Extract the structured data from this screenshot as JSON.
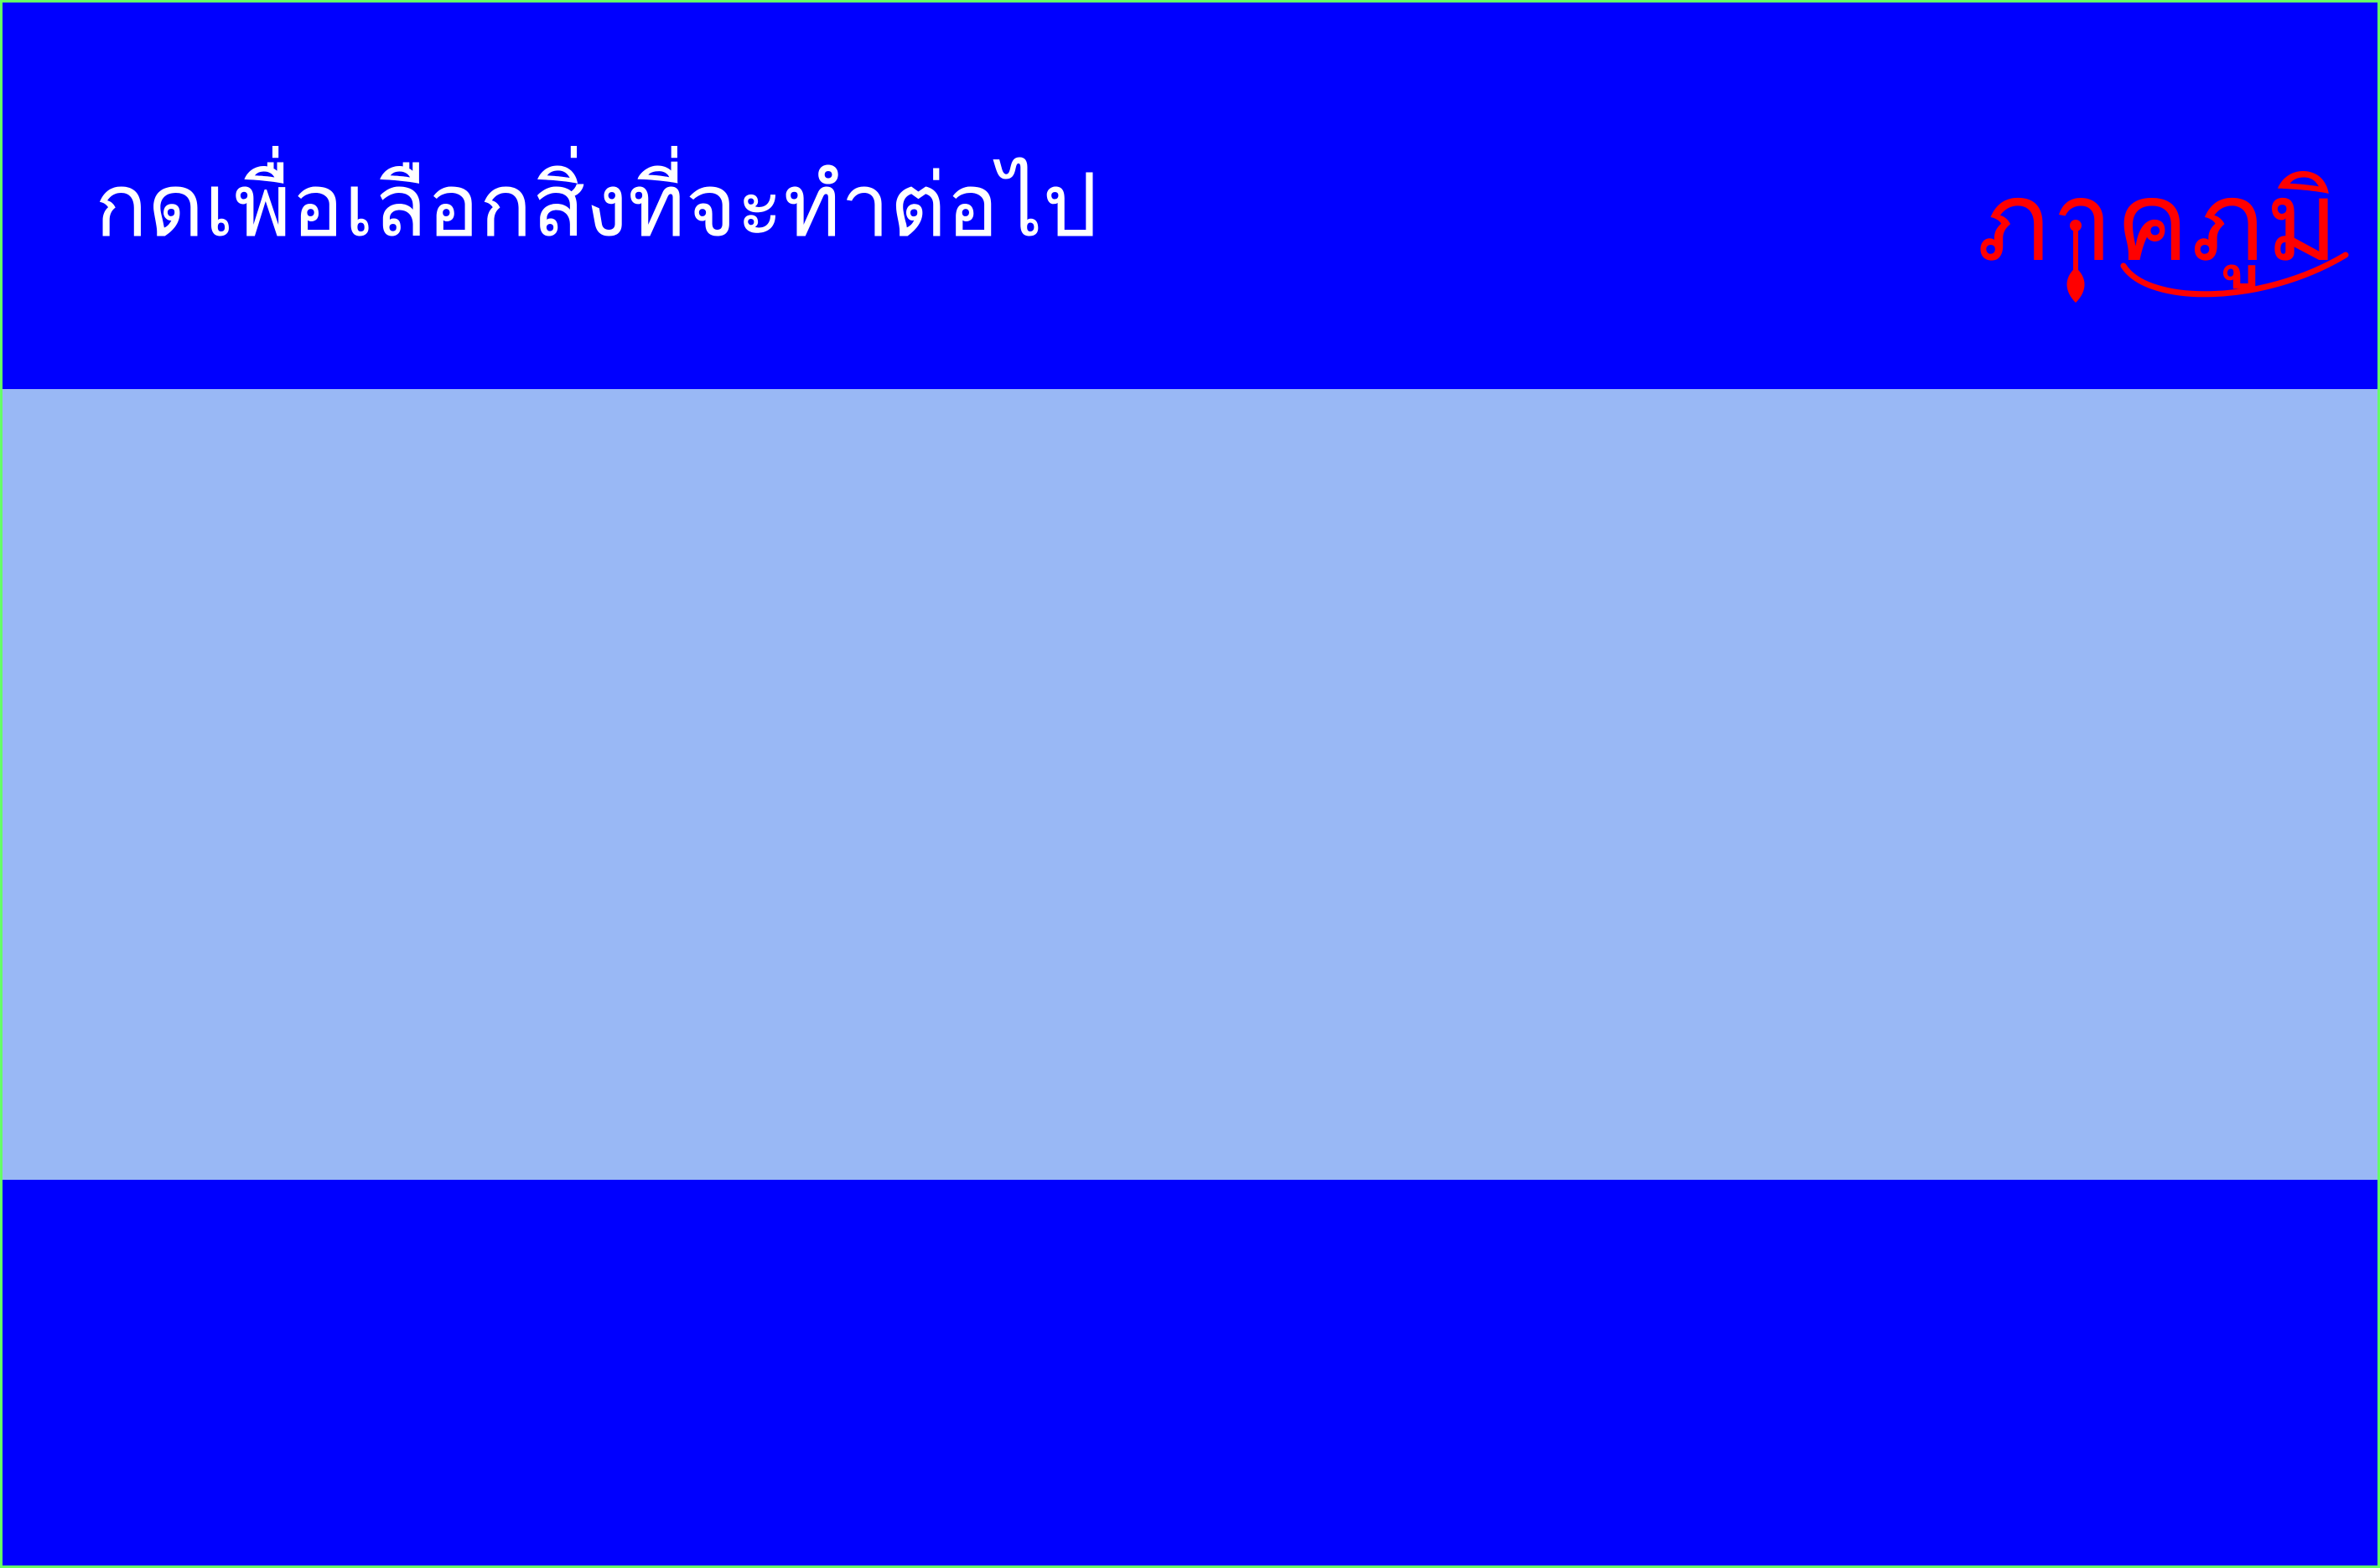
{
  "header": {
    "prompt": "กดเพื่อเลือกสิ่งที่จะทำต่อไป",
    "logo_text": "ภาคภูมิ"
  },
  "colors": {
    "header_bg": "#0000ff",
    "content_bg": "#99b8f5",
    "footer_bg": "#0000ff",
    "prompt_text": "#ffffff",
    "logo": "#ff0000",
    "frame_border": "#66ff66"
  }
}
